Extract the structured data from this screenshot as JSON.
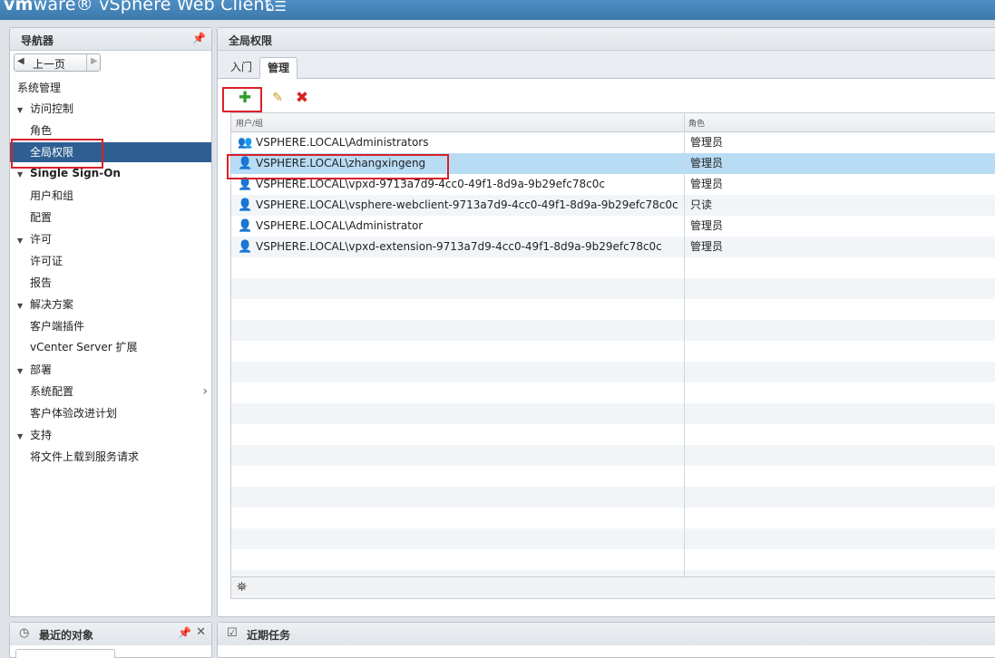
{
  "header": {
    "brand_bold": "vm",
    "brand_rest": "ware® vSphere Web Client",
    "home_icon": "home-menu-icon"
  },
  "navigator": {
    "title": "导航器",
    "back_label": "上一页",
    "items": [
      {
        "label": "系统管理",
        "level": 0
      },
      {
        "label": "访问控制",
        "level": 1,
        "expanded": true
      },
      {
        "label": "角色",
        "level": 2
      },
      {
        "label": "全局权限",
        "level": 2,
        "selected": true
      },
      {
        "label": "Single Sign-On",
        "level": 1,
        "expanded": true
      },
      {
        "label": "用户和组",
        "level": 2
      },
      {
        "label": "配置",
        "level": 2
      },
      {
        "label": "许可",
        "level": 1,
        "expanded": true
      },
      {
        "label": "许可证",
        "level": 2
      },
      {
        "label": "报告",
        "level": 2
      },
      {
        "label": "解决方案",
        "level": 1,
        "expanded": true
      },
      {
        "label": "客户端插件",
        "level": 2
      },
      {
        "label": "vCenter Server 扩展",
        "level": 2
      },
      {
        "label": "部署",
        "level": 1,
        "expanded": true
      },
      {
        "label": "系统配置",
        "level": 2
      },
      {
        "label": "客户体验改进计划",
        "level": 2
      },
      {
        "label": "支持",
        "level": 1,
        "expanded": true
      },
      {
        "label": "将文件上载到服务请求",
        "level": 2
      }
    ]
  },
  "main": {
    "title": "全局权限",
    "tabs": [
      {
        "label": "入门",
        "active": false
      },
      {
        "label": "管理",
        "active": true
      }
    ],
    "toolbar": {
      "add_icon": "plus-icon",
      "edit_icon": "pencil-icon",
      "delete_icon": "delete-x-icon"
    },
    "grid": {
      "columns": [
        "用户/组",
        "角色"
      ],
      "rows": [
        {
          "user": "VSPHERE.LOCAL\\Administrators",
          "role": "管理员",
          "icon": "group-icon"
        },
        {
          "user": "VSPHERE.LOCAL\\zhangxingeng",
          "role": "管理员",
          "icon": "user-icon",
          "selected": true
        },
        {
          "user": "VSPHERE.LOCAL\\vpxd-9713a7d9-4cc0-49f1-8d9a-9b29efc78c0c",
          "role": "管理员",
          "icon": "user-icon"
        },
        {
          "user": "VSPHERE.LOCAL\\vsphere-webclient-9713a7d9-4cc0-49f1-8d9a-9b29efc78c0c",
          "role": "只读",
          "icon": "user-icon"
        },
        {
          "user": "VSPHERE.LOCAL\\Administrator",
          "role": "管理员",
          "icon": "user-icon"
        },
        {
          "user": "VSPHERE.LOCAL\\vpxd-extension-9713a7d9-4cc0-49f1-8d9a-9b29efc78c0c",
          "role": "管理员",
          "icon": "user-icon"
        }
      ]
    }
  },
  "bottom": {
    "recent_objects_title": "最近的对象",
    "recent_tasks_title": "近期任务"
  }
}
